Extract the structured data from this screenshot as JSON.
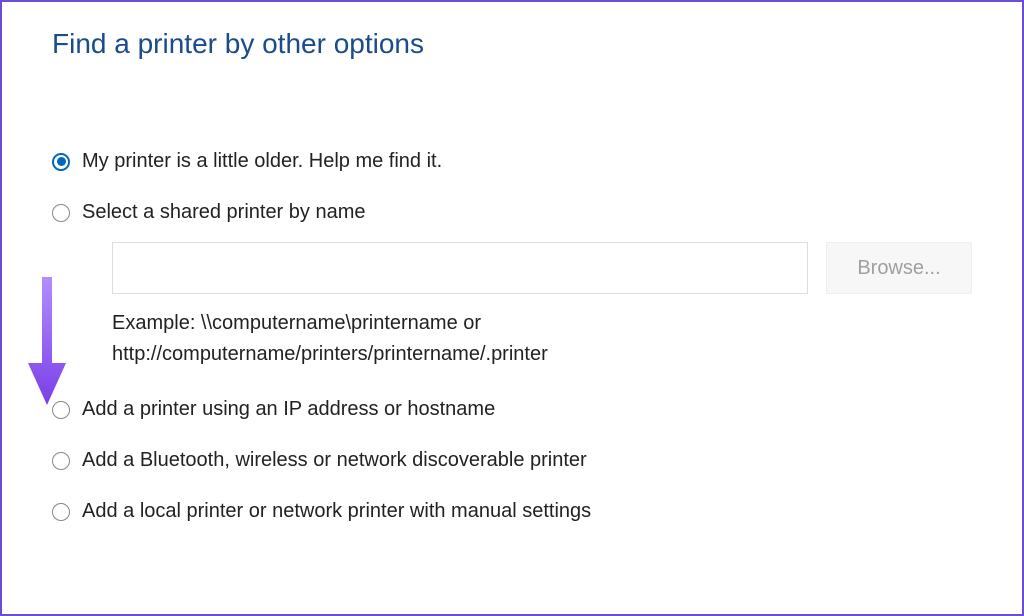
{
  "title": "Find a printer by other options",
  "options": {
    "older": "My printer is a little older. Help me find it.",
    "shared": "Select a shared printer by name",
    "ip": "Add a printer using an IP address or hostname",
    "bluetooth": "Add a Bluetooth, wireless or network discoverable printer",
    "local": "Add a local printer or network printer with manual settings"
  },
  "shared_section": {
    "input_value": "",
    "browse_label": "Browse...",
    "example_text": "Example: \\\\computername\\printername or http://computername/printers/printername/.printer"
  },
  "selected_option": "older",
  "annotation_color": "#8a4dff"
}
